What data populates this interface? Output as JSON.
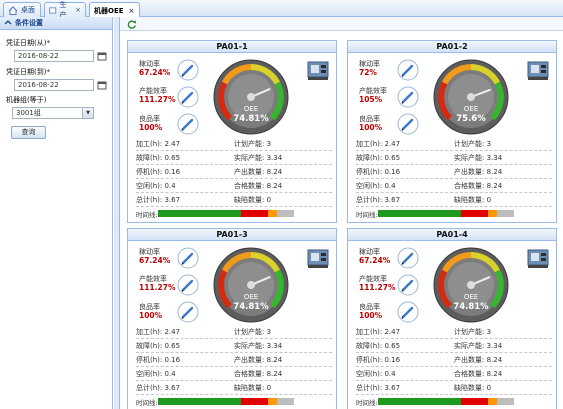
{
  "tabs": [
    {
      "label": "桌面",
      "icon": "home-icon",
      "closable": false,
      "active": false
    },
    {
      "label": "生产",
      "icon": "doc-icon",
      "closable": true,
      "active": false
    },
    {
      "label": "机器OEE",
      "icon": "",
      "closable": true,
      "active": true
    }
  ],
  "sidebar": {
    "title": "条件设置",
    "from_label": "凭证日期(从)*",
    "from_value": "2016-08-22",
    "to_label": "凭证日期(到)*",
    "to_value": "2016-08-22",
    "machine_label": "机器组(等于)",
    "machine_value": "3001组",
    "query_label": "查询"
  },
  "gauge_label": "OEE",
  "row_labels": {
    "proc": "加工(h):",
    "plan": "计划产能:",
    "fault": "故障(h):",
    "actual": "实际产能:",
    "stop": "停机(h):",
    "output": "产出数量:",
    "idle": "空闲(h):",
    "good": "合格数量:",
    "total": "总计(h):",
    "defect": "缺陷数量:",
    "timeline": "时间线:"
  },
  "rate_labels": {
    "util": "稼动率",
    "perf": "产能效率",
    "quality": "良品率"
  },
  "cards": [
    {
      "title": "PA01-1",
      "util": "67.24%",
      "perf": "111.27%",
      "quality": "100%",
      "oee": "74.81%",
      "oee_value": 74.81,
      "proc": "2.47",
      "plan": "3",
      "fault": "0.65",
      "actual": "3.34",
      "stop": "0.16",
      "output": "8.24",
      "idle": "0.4",
      "good": "8.24",
      "total": "3.67",
      "defect": "0"
    },
    {
      "title": "PA01-2",
      "util": "72%",
      "perf": "105%",
      "quality": "100%",
      "oee": "75.6%",
      "oee_value": 75.6,
      "proc": "2.47",
      "plan": "3",
      "fault": "0.65",
      "actual": "3.34",
      "stop": "0.16",
      "output": "8.24",
      "idle": "0.4",
      "good": "8.24",
      "total": "3.67",
      "defect": "0"
    },
    {
      "title": "PA01-3",
      "util": "67.24%",
      "perf": "111.27%",
      "quality": "100%",
      "oee": "74.81%",
      "oee_value": 74.81,
      "proc": "2.47",
      "plan": "3",
      "fault": "0.65",
      "actual": "3.34",
      "stop": "0.16",
      "output": "8.24",
      "idle": "0.4",
      "good": "8.24",
      "total": "3.67",
      "defect": "0"
    },
    {
      "title": "PA01-4",
      "util": "67.24%",
      "perf": "111.27%",
      "quality": "100%",
      "oee": "74.81%",
      "oee_value": 74.81,
      "proc": "2.47",
      "plan": "3",
      "fault": "0.65",
      "actual": "3.34",
      "stop": "0.16",
      "output": "8.24",
      "idle": "0.4",
      "good": "8.24",
      "total": "3.67",
      "defect": "0"
    }
  ],
  "timeline_segments": [
    {
      "color": "#1e9a1e",
      "share": 0.49
    },
    {
      "color": "#e00000",
      "share": 0.16
    },
    {
      "color": "#ff9900",
      "share": 0.05
    },
    {
      "color": "#bdbdbd",
      "share": 0.1
    }
  ],
  "colors": {
    "accent": "#15428b",
    "value_red": "#c00000",
    "border": "#99bbe8"
  }
}
